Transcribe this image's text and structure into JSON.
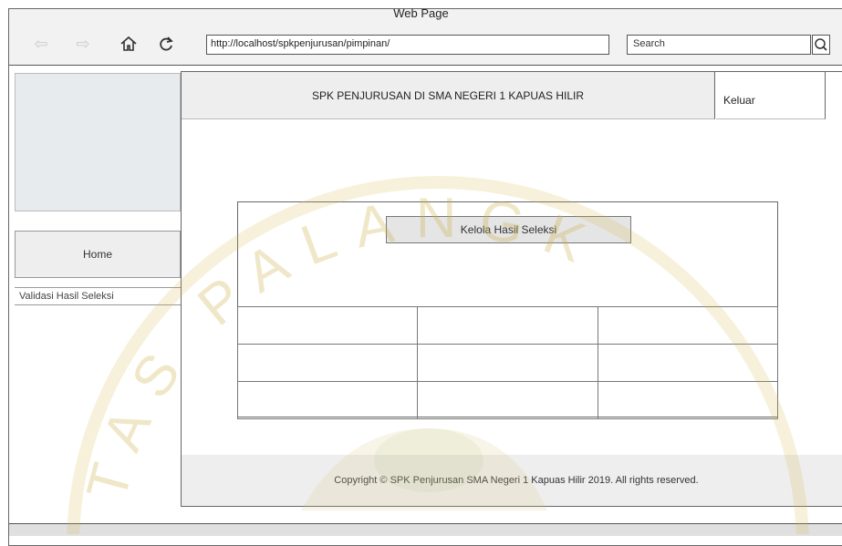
{
  "browser": {
    "window_title": "Web Page",
    "url": "http://localhost/spkpenjurusan/pimpinan/",
    "search_placeholder": "Search"
  },
  "header": {
    "title": "SPK PENJURUSAN DI SMA NEGERI 1 KAPUAS HILIR",
    "logout_label": "Keluar"
  },
  "sidebar": {
    "home_label": "Home",
    "items": [
      {
        "label": "Validasi Hasil Seleksi"
      }
    ]
  },
  "main": {
    "panel_button_label": "Kelola Hasil Seleksi",
    "table_rows": 3,
    "table_cols": 3
  },
  "footer": {
    "copyright": "Copyright © SPK Penjurusan SMA Negeri 1 Kapuas Hilir 2019. All rights reserved."
  },
  "watermark": {
    "text": "PALANGKARAYA",
    "visible_text": "TAS PALANGK",
    "color": "#c9a227"
  },
  "icons": [
    "back-arrow-icon",
    "forward-arrow-icon",
    "home-icon",
    "refresh-icon",
    "search-icon"
  ]
}
